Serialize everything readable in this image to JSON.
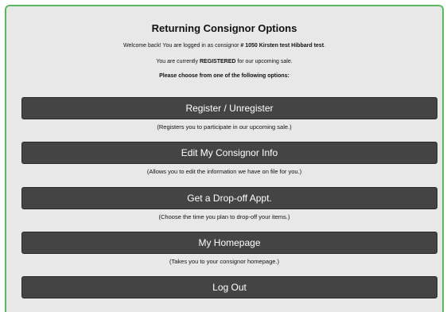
{
  "panel": {
    "title": "Returning Consignor Options",
    "welcome_prefix": "Welcome back! You are logged in as consignor ",
    "consignor_name": "# 1050 Kirsten test Hibbard test",
    "welcome_suffix": ".",
    "registered_prefix": "You are currently ",
    "registered_status": "REGISTERED",
    "registered_suffix": " for our upcoming sale.",
    "choose_prompt": "Please choose from one of the following options:"
  },
  "options": [
    {
      "label": "Register / Unregister",
      "hint": "(Registers you to participate in our upcoming sale.)"
    },
    {
      "label": "Edit My Consignor Info",
      "hint": "(Allows you to edit the information we have on file for you.)"
    },
    {
      "label": "Get a Drop-off Appt.",
      "hint": "(Choose the time you plan to drop-off your items.)"
    },
    {
      "label": "My Homepage",
      "hint": "(Takes you to your consignor homepage.)"
    },
    {
      "label": "Log Out"
    }
  ],
  "colors": {
    "panel_border": "#5cb85c",
    "panel_background": "#e8e8e8",
    "button_background": "#444444",
    "button_text": "#ffffff"
  }
}
